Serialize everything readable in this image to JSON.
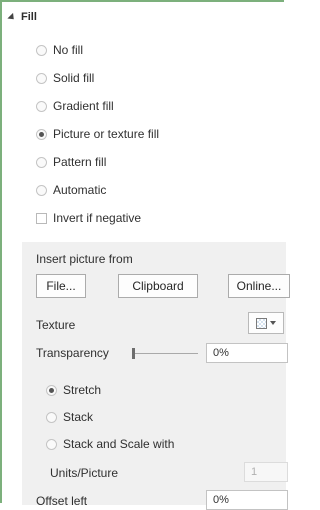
{
  "section": {
    "title": "Fill"
  },
  "fill_options": [
    {
      "label": "No fill",
      "selected": false
    },
    {
      "label": "Solid fill",
      "selected": false
    },
    {
      "label": "Gradient fill",
      "selected": false
    },
    {
      "label": "Picture or texture fill",
      "selected": true
    },
    {
      "label": "Pattern fill",
      "selected": false
    },
    {
      "label": "Automatic",
      "selected": false
    }
  ],
  "invert_if_negative": {
    "label": "Invert if negative",
    "checked": false
  },
  "insert_picture": {
    "label": "Insert picture from",
    "file_button": "File...",
    "clipboard_button": "Clipboard",
    "online_button": "Online..."
  },
  "texture": {
    "label": "Texture"
  },
  "transparency": {
    "label": "Transparency",
    "value": "0%",
    "level": 0
  },
  "stretch_options": [
    {
      "label": "Stretch",
      "selected": true
    },
    {
      "label": "Stack",
      "selected": false
    },
    {
      "label": "Stack and Scale with",
      "selected": false
    }
  ],
  "units_picture": {
    "label": "Units/Picture",
    "value": "1"
  },
  "offset_left": {
    "label": "Offset left",
    "value": "0%"
  }
}
